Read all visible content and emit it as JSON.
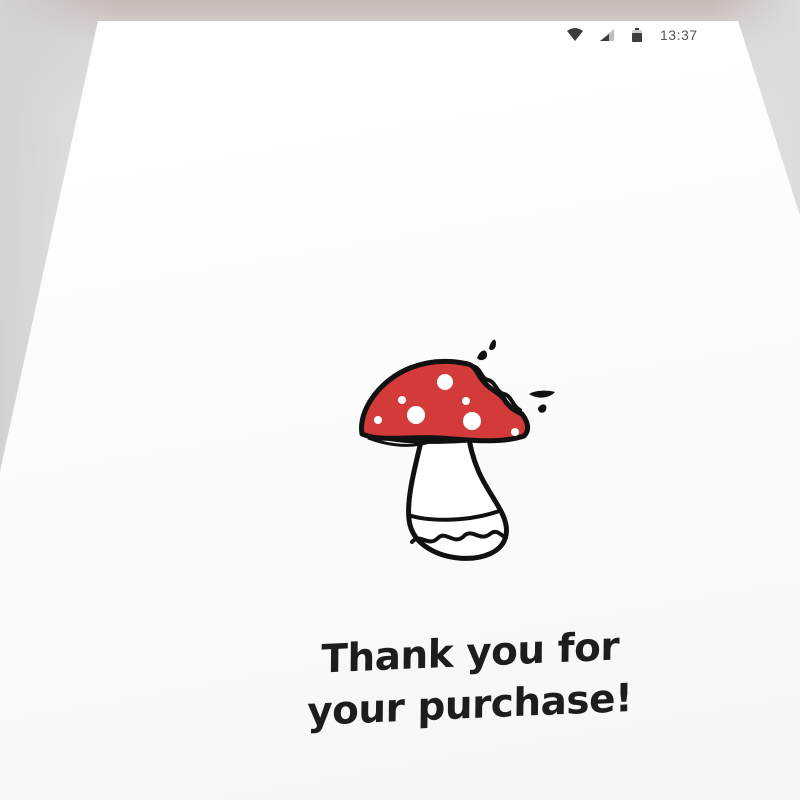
{
  "status_bar": {
    "time": "13:37",
    "icons": [
      "wifi-icon",
      "signal-icon",
      "battery-icon"
    ]
  },
  "message": {
    "line1": "Thank you for",
    "line2": "your purchase!"
  },
  "illustration": {
    "name": "bitten-mushroom",
    "cap_color": "#d33a3a",
    "outline_color": "#111111"
  }
}
